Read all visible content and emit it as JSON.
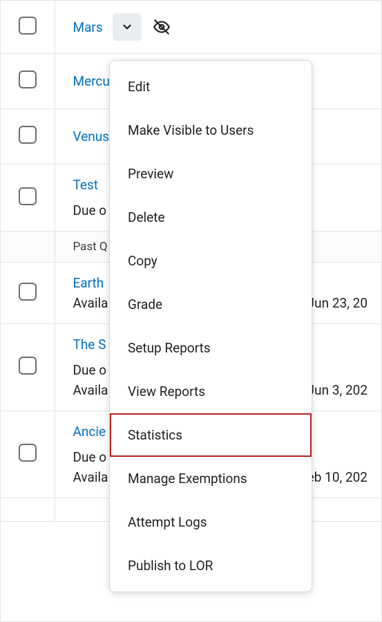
{
  "rows": [
    {
      "title": "Mars"
    },
    {
      "title": "Mercu"
    },
    {
      "title": "Venus"
    },
    {
      "title": "Test",
      "due": "Due o"
    },
    {
      "section": "Past Q"
    },
    {
      "title": "Earth",
      "avail": "Availa",
      "date": "Jun 23, 20"
    },
    {
      "title": "The S",
      "due": "Due o",
      "avail": "Availa",
      "date": "Jun 3, 202"
    },
    {
      "title": "Ancie",
      "due": "Due o",
      "avail": "Availa",
      "date": "eb 10, 202"
    },
    {
      "title": "— —"
    }
  ],
  "menu": {
    "items": [
      "Edit",
      "Make Visible to Users",
      "Preview",
      "Delete",
      "Copy",
      "Grade",
      "Setup Reports",
      "View Reports",
      "Statistics",
      "Manage Exemptions",
      "Attempt Logs",
      "Publish to LOR"
    ],
    "highlight_index": 8
  }
}
